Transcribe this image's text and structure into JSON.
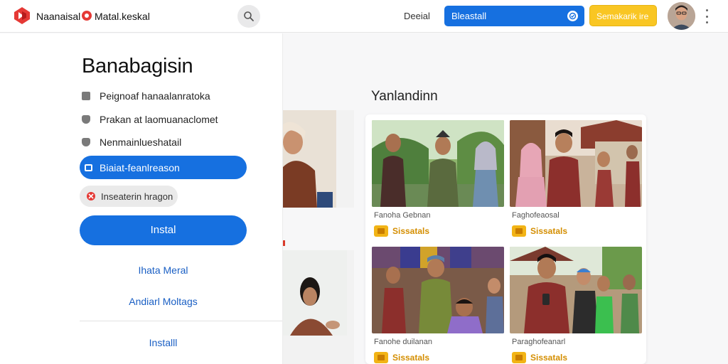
{
  "header": {
    "brand": "Naanaisal",
    "brand_secondary": "Matal.keskal",
    "nav_link": "Deeial",
    "blue_field": "Bleastall",
    "yellow_button": "Semakarik ire"
  },
  "panel": {
    "title": "Banabagisin",
    "options": [
      "Peignoaf hanaalanratoka",
      "Prakan at laomuanaclomet",
      "Nenmainlueshatail"
    ],
    "selected_option": "Biaiat-feanlreason",
    "chip": "Inseaterin hragon",
    "install_button": "Instal",
    "link1": "Ihata Meral",
    "link2": "Andiarl Moltags",
    "link3": "Installl"
  },
  "content": {
    "title": "Yanlandinn",
    "cards": [
      {
        "caption": "Fanoha Gebnan",
        "stat": "Sissatals"
      },
      {
        "caption": "Faghofeaosal",
        "stat": "Sissatals"
      },
      {
        "caption": "Fanohe duilanan",
        "stat": "Sissatals"
      },
      {
        "caption": "Paraghofeanarl",
        "stat": "Sissatals"
      }
    ]
  },
  "colors": {
    "accent_blue": "#1670e0",
    "accent_yellow": "#f9c623",
    "logo_red": "#e53935"
  }
}
